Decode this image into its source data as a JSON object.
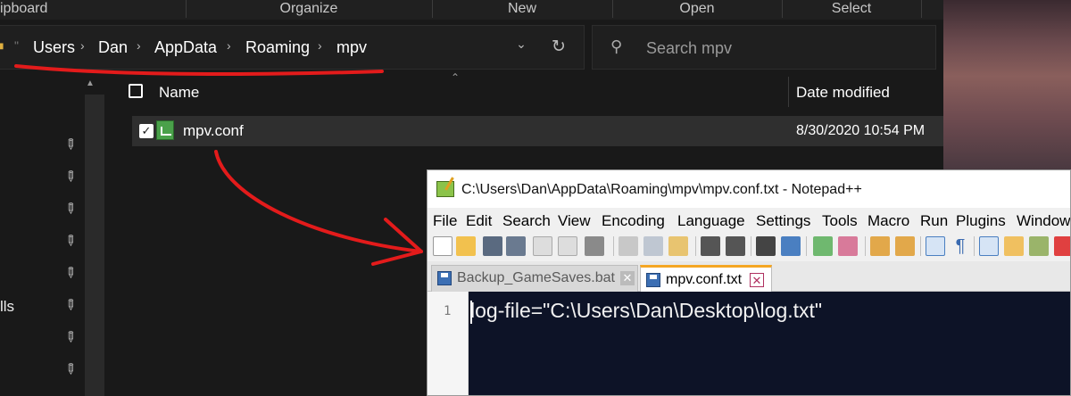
{
  "ribbon": {
    "groups": [
      "ipboard",
      "Organize",
      "New",
      "Open",
      "Select"
    ]
  },
  "address_bar": {
    "crumbs": [
      "Users",
      "Dan",
      "AppData",
      "Roaming",
      "mpv"
    ],
    "dropdown_icon": "chevron-down-icon",
    "refresh_icon": "refresh-icon"
  },
  "search": {
    "placeholder": "Search mpv",
    "icon": "search-icon"
  },
  "nav_pane": {
    "label": "lls",
    "pin_icon": "pin-icon"
  },
  "file_list": {
    "columns": {
      "name": "Name",
      "date": "Date modified"
    },
    "rows": [
      {
        "name": "mpv.conf",
        "date": "8/30/2020 10:54 PM",
        "checked": true
      }
    ]
  },
  "notepad": {
    "title": "C:\\Users\\Dan\\AppData\\Roaming\\mpv\\mpv.conf.txt - Notepad++",
    "menu": [
      "File",
      "Edit",
      "Search",
      "View",
      "Encoding",
      "Language",
      "Settings",
      "Tools",
      "Macro",
      "Run",
      "Plugins",
      "Window"
    ],
    "tabs": [
      {
        "label": "Backup_GameSaves.bat",
        "active": false
      },
      {
        "label": "mpv.conf.txt",
        "active": true
      }
    ],
    "editor": {
      "line_number": "1",
      "line": "log-file=\"C:\\Users\\Dan\\Desktop\\log.txt\""
    }
  },
  "colors": {
    "annotation": "#e31b1b",
    "explorer_bg": "#191919",
    "editor_bg": "#0d1327",
    "active_tab_accent": "#f5a623"
  }
}
